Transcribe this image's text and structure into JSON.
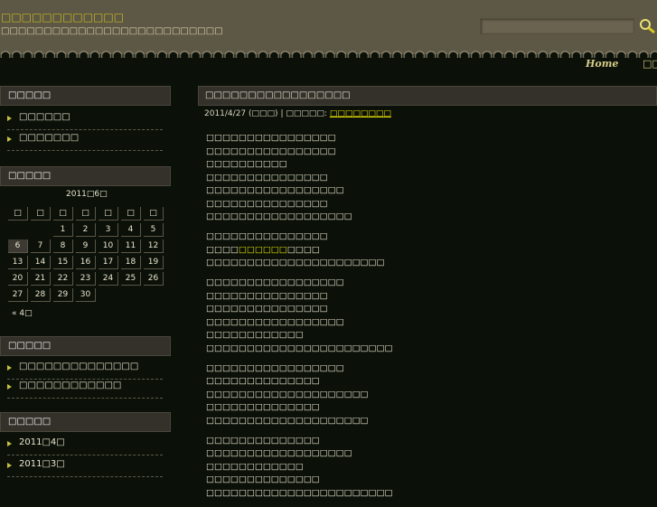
{
  "header": {
    "site_title": "□□□□□□□□□□□□",
    "site_description": "□□□□□□□□□□□□□□□□□□□□□□□□□□",
    "search_placeholder": ""
  },
  "nav": {
    "home": "Home",
    "other": "□□"
  },
  "sidebar": {
    "section1": {
      "title": "□□□□□",
      "items": [
        "□□□□□□",
        "□□□□□□□"
      ]
    },
    "calendar": {
      "title": "□□□□□",
      "caption": "2011□6□",
      "weekdays": [
        "□",
        "□",
        "□",
        "□",
        "□",
        "□",
        "□"
      ],
      "weeks": [
        [
          "",
          "",
          "1",
          "2",
          "3",
          "4",
          "5"
        ],
        [
          "6",
          "7",
          "8",
          "9",
          "10",
          "11",
          "12"
        ],
        [
          "13",
          "14",
          "15",
          "16",
          "17",
          "18",
          "19"
        ],
        [
          "20",
          "21",
          "22",
          "23",
          "24",
          "25",
          "26"
        ],
        [
          "27",
          "28",
          "29",
          "30",
          "",
          "",
          ""
        ]
      ],
      "today": "6",
      "prev": "« 4□"
    },
    "section3": {
      "title": "□□□□□",
      "items": [
        "□□□□□□□□□□□□□□",
        "□□□□□□□□□□□□"
      ]
    },
    "archives": {
      "title": "□□□□□",
      "items": [
        "2011□4□",
        "2011□3□"
      ]
    }
  },
  "post": {
    "title": "□□□□□□□□□□□□□□□□□",
    "date": "2011/4/27",
    "day": "(□□□)",
    "separator": "|",
    "category_label": "□□□□□:",
    "category": "□□□□□□□□",
    "paragraphs": [
      [
        "□□□□□□□□□□□□□□□□",
        "□□□□□□□□□□□□□□□□",
        "□□□□□□□□□□",
        "□□□□□□□□□□□□□□□",
        "□□□□□□□□□□□□□□□□□",
        "□□□□□□□□□□□□□□□",
        "□□□□□□□□□□□□□□□□□□"
      ],
      [
        "□□□□□□□□□□□□□□□",
        "□□□□□□□□□□□□□□□□□□□□□□"
      ],
      [
        "□□□□□□□□□□□□□□□□□",
        "□□□□□□□□□□□□□□□",
        "□□□□□□□□□□□□□□□",
        "□□□□□□□□□□□□□□□□□",
        "□□□□□□□□□□□□",
        "□□□□□□□□□□□□□□□□□□□□□□□"
      ],
      [
        "□□□□□□□□□□□□□□□□□",
        "□□□□□□□□□□□□□□",
        "□□□□□□□□□□□□□□□□□□□□",
        "□□□□□□□□□□□□□□",
        "□□□□□□□□□□□□□□□□□□□□"
      ],
      [
        "□□□□□□□□□□□□□□",
        "□□□□□□□□□□□□□□□□□□",
        "□□□□□□□□□□□□",
        "□□□□□□□□□□□□□□",
        "□□□□□□□□□□□□□□□□□□□□□□□"
      ]
    ],
    "link_line": {
      "before": "□□□□",
      "link": "□□□□□□",
      "after": "□□□□"
    }
  }
}
